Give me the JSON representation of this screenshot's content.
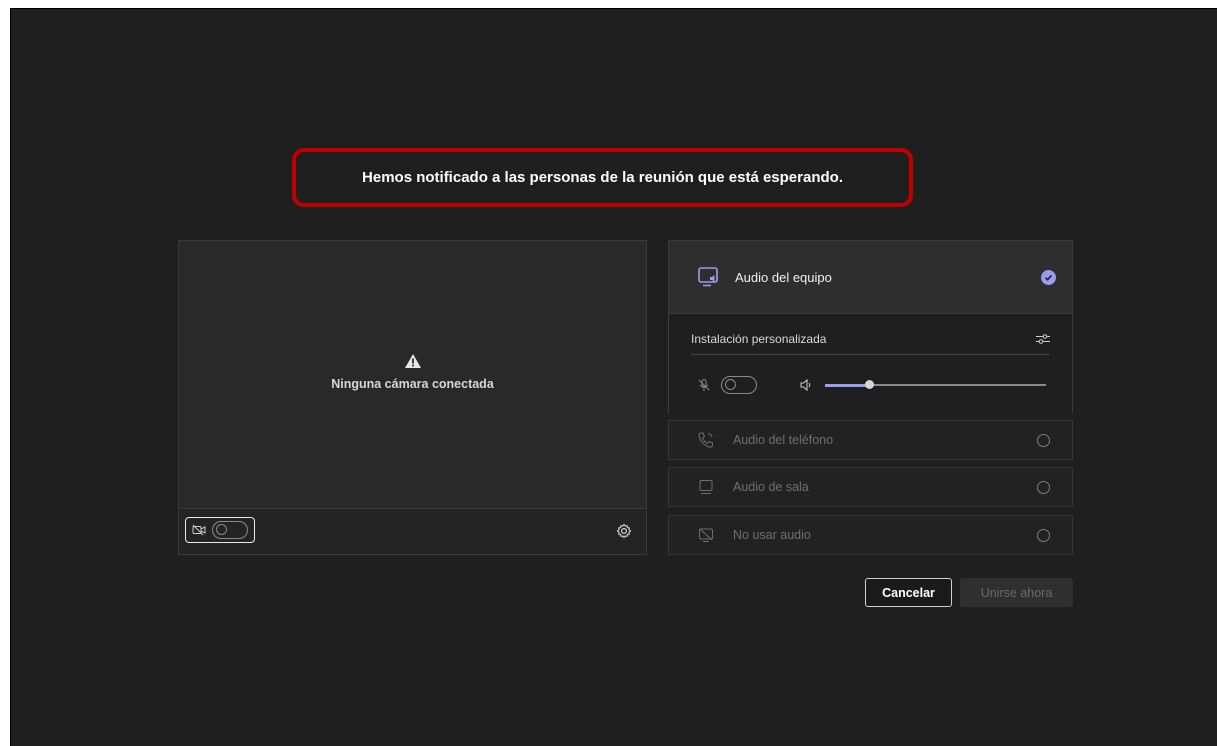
{
  "status_message": "Hemos notificado a las personas de la reunión que está esperando.",
  "camera_preview": {
    "no_camera_text": "Ninguna cámara conectada",
    "camera_toggle_on": false
  },
  "audio_options": {
    "computer_audio": {
      "label": "Audio del equipo",
      "selected": true,
      "custom_setup_label": "Instalación personalizada",
      "mic_toggle_on": false,
      "speaker_volume": 0.2
    },
    "phone_audio": {
      "label": "Audio del teléfono",
      "selected": false
    },
    "room_audio": {
      "label": "Audio de sala",
      "selected": false
    },
    "no_audio": {
      "label": "No usar audio",
      "selected": false
    }
  },
  "buttons": {
    "cancel": "Cancelar",
    "join_now": "Unirse ahora"
  },
  "colors": {
    "accent": "#9b9cf0",
    "highlight_border": "#c00000",
    "background": "#1f1f1f"
  }
}
